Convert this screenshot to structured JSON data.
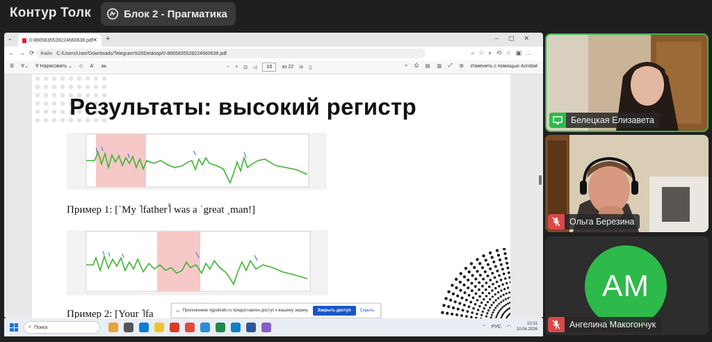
{
  "app": {
    "title": "Контур Толк",
    "room": "Блок 2 - Прагматика"
  },
  "browser": {
    "tab_title": "0-8665835528224660638.pdf",
    "url_label": "Файл",
    "url": "C:/Users/User/Downloads/Telegram%20Desktop/0-8665835528224660638.pdf",
    "toolbar": {
      "draw": "Нарисовать",
      "page_current": "10",
      "page_total": "из 22",
      "edit_acrobat": "Изменить с помощью Acrobat"
    }
  },
  "slide": {
    "title": "Результаты: высокий регистр",
    "example1": "Пример 1: [ˈMy ˥father˥̀ was a ˈgreat ˎman!]",
    "example2": "Пример 2: [Your ˥fa"
  },
  "share_notice": {
    "text": "Приложению ngpuktalk.ru предоставлен доступ к вашему экрану.",
    "share_button": "Закрыть доступ",
    "hide_button": "Скрыть"
  },
  "taskbar": {
    "search": "Поиск",
    "lang": "РУС",
    "time": "13:31",
    "date": "10.04.2026"
  },
  "participants": [
    {
      "name": "Белецкая Елизавета",
      "status": "screen-sharing"
    },
    {
      "name": "Ольга Березина",
      "status": "muted"
    },
    {
      "name": "Ангелина Макогончук",
      "status": "muted",
      "initials": "АМ"
    }
  ],
  "colors": {
    "accent_green": "#2dba4a",
    "muted_red": "#d94848",
    "chart_line": "#3cb531",
    "highlight": "#f7c8c8"
  }
}
